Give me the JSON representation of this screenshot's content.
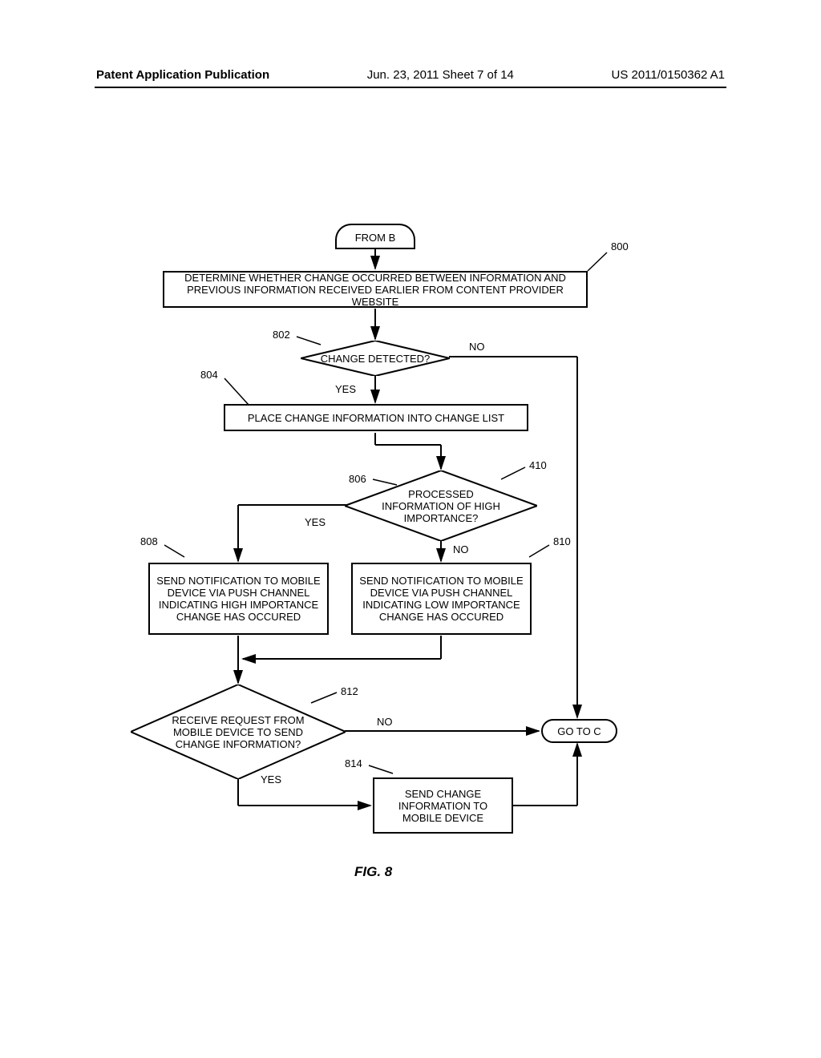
{
  "header": {
    "left": "Patent Application Publication",
    "center": "Jun. 23, 2011  Sheet 7 of 14",
    "right": "US 2011/0150362 A1"
  },
  "nodes": {
    "fromB": "FROM B",
    "box800": "DETERMINE WHETHER CHANGE OCCURRED BETWEEN INFORMATION AND PREVIOUS INFORMATION RECEIVED EARLIER FROM CONTENT PROVIDER WEBSITE",
    "d802": "CHANGE DETECTED?",
    "box804": "PLACE CHANGE INFORMATION INTO CHANGE LIST",
    "d806": "PROCESSED INFORMATION OF HIGH IMPORTANCE?",
    "box808": "SEND NOTIFICATION TO MOBILE DEVICE VIA PUSH CHANNEL INDICATING HIGH IMPORTANCE CHANGE HAS OCCURED",
    "box810": "SEND NOTIFICATION TO MOBILE DEVICE VIA PUSH CHANNEL INDICATING LOW IMPORTANCE CHANGE HAS OCCURED",
    "d812": "RECEIVE REQUEST FROM MOBILE DEVICE TO SEND CHANGE INFORMATION?",
    "box814": "SEND CHANGE INFORMATION TO MOBILE DEVICE",
    "gotoC": "GO TO C"
  },
  "labels": {
    "no": "NO",
    "yes": "YES"
  },
  "refs": {
    "r800": "800",
    "r802": "802",
    "r804": "804",
    "r806": "806",
    "r410": "410",
    "r808": "808",
    "r810": "810",
    "r812": "812",
    "r814": "814"
  },
  "caption": "FIG. 8"
}
